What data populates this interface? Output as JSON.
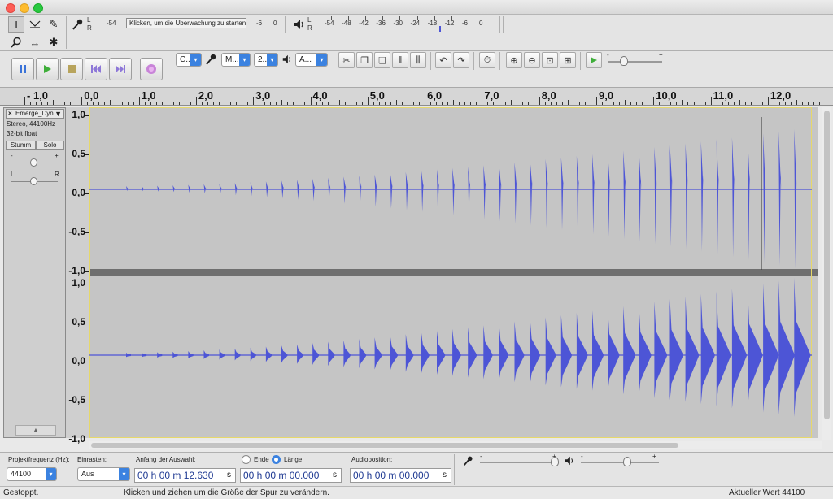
{
  "toolbar": {
    "meter": {
      "record_scale": [
        "L",
        "R",
        "-54",
        "0",
        "-6"
      ],
      "record_prompt": "Klicken, um die Überwachung zu starten",
      "play_scale": [
        "L",
        "R",
        "-54",
        "-48",
        "-42",
        "-36",
        "-30",
        "-24",
        "-18",
        "-12",
        "-6",
        "0"
      ],
      "playback_level": 0.74
    },
    "device": {
      "host_label": "C..",
      "record_device_label": "M...",
      "channels_label": "2...",
      "playback_device_label": "A..."
    },
    "play_at_speed_scale": [
      "-",
      "+"
    ]
  },
  "ruler": {
    "labels": [
      "- 1,0",
      "0,0",
      "1,0",
      "2,0",
      "3,0",
      "4,0",
      "5,0",
      "6,0",
      "7,0",
      "8,0",
      "9,0",
      "10,0",
      "11,0",
      "12,0"
    ]
  },
  "track": {
    "name": "Emerge_Dyn",
    "info_line1": "Stereo, 44100Hz",
    "info_line2": "32-bit float",
    "mute_label": "Stumm",
    "solo_label": "Solo",
    "gain_scale": [
      "-",
      "+"
    ],
    "pan_scale": [
      "L",
      "R"
    ],
    "channel_scale": [
      "1,0",
      "0,5",
      "0,0",
      "-0,5",
      "-1,0"
    ],
    "waveform_color": "#4d55d6"
  },
  "selectionbar": {
    "rate_label": "Projektfrequenz (Hz):",
    "rate_value": "44100",
    "snap_label": "Einrasten:",
    "snap_value": "Aus",
    "start_label": "Anfang der Auswahl:",
    "start_value": "00 h 00 m 12.630",
    "end_option": "Ende",
    "length_option": "Länge",
    "end_value": "00 h 00 m 00.000",
    "time_suffix": "s",
    "audiopos_label": "Audioposition:",
    "audiopos_value": "00 h 00 m 00.000",
    "mixer_scale": [
      "-",
      "+"
    ]
  },
  "status": {
    "state": "Gestoppt.",
    "hint": "Klicken und ziehen um die Größe der Spur zu verändern.",
    "value": "Aktueller Wert 44100"
  }
}
